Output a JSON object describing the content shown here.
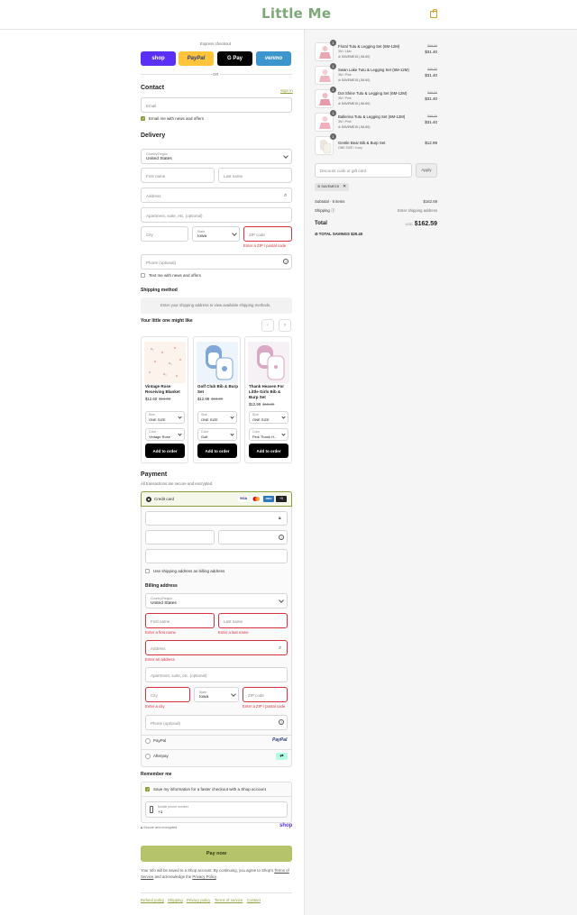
{
  "header": {
    "logo": "Little Me"
  },
  "express": {
    "label": "Express checkout",
    "buttons": [
      "shop",
      "PayPal",
      "G Pay",
      "venmo"
    ],
    "or": "OR"
  },
  "contact": {
    "title": "Contact",
    "signin": "Sign in",
    "email_placeholder": "Email",
    "news_label": "Email me with news and offers"
  },
  "delivery": {
    "title": "Delivery",
    "country_label": "Country/Region",
    "country_value": "United States",
    "first_name": "First name",
    "last_name": "Last name",
    "address": "Address",
    "apartment": "Apartment, suite, etc. (optional)",
    "city": "City",
    "state_label": "State",
    "state_value": "Iowa",
    "zip": "ZIP code",
    "zip_error": "Enter a ZIP / postal code",
    "phone": "Phone (optional)",
    "text_label": "Text me with news and offers"
  },
  "shipping": {
    "title": "Shipping method",
    "message": "Enter your shipping address to view available shipping methods."
  },
  "upsell": {
    "title": "Your little one might like",
    "products": [
      {
        "name": "Vintage Rose Receiving Blanket",
        "price": "$12.60",
        "old": "$18.00",
        "size_label": "Size",
        "size": "ONE SIZE",
        "color_label": "Color",
        "color": "Vintage Rose",
        "button": "Add to order"
      },
      {
        "name": "Golf Club Bib & Burp Set",
        "price": "$12.99",
        "old": "$18.00",
        "size_label": "Size",
        "size": "ONE SIZE",
        "color_label": "Color",
        "color": "Golf",
        "button": "Add to order"
      },
      {
        "name": "Thank Heaven For Little Girls Bib & Burp Set",
        "price": "$12.99",
        "old": "$18.00",
        "size_label": "Size",
        "size": "ONE SIZE",
        "color_label": "Color",
        "color": "Pink Thank H...",
        "button": "Add to order"
      }
    ]
  },
  "payment": {
    "title": "Payment",
    "subtitle": "All transactions are secure and encrypted.",
    "credit_card": "Credit card",
    "cards": [
      "VISA",
      "MC",
      "AMEX",
      "+5"
    ],
    "billing_same": "Use shipping address as billing address",
    "billing_title": "Billing address",
    "country_label": "Country/Region",
    "country_value": "United States",
    "first_name": "First name",
    "first_error": "Enter a first name",
    "last_name": "Last name",
    "last_error": "Enter a last name",
    "address": "Address",
    "address_error": "Enter an address",
    "apartment": "Apartment, suite, etc. (optional)",
    "city": "City",
    "city_error": "Enter a city",
    "state_label": "State",
    "state_value": "Iowa",
    "zip": "ZIP code",
    "zip_error": "Enter a ZIP / postal code",
    "phone": "Phone (optional)",
    "paypal": "PayPal",
    "paypal_logo": "PayPal",
    "afterpay": "Afterpay"
  },
  "remember": {
    "title": "Remember me",
    "save_label": "Save my information for a faster checkout with a Shop account",
    "mobile_label": "Mobile phone number",
    "mobile_value": "+1",
    "secure": "Secure and encrypted",
    "shop": "shop"
  },
  "pay_now": "Pay now",
  "disclaimer_pre": "Your info will be saved to a Shop account. By continuing, you agree to Shop's ",
  "terms": "Terms of Service",
  "disclaimer_mid": " and acknowledge the ",
  "privacy": "Privacy Policy",
  "disclaimer_end": ".",
  "footer": [
    "Refund policy",
    "Shipping",
    "Privacy policy",
    "Terms of service",
    "Contact"
  ],
  "order": {
    "items": [
      {
        "qty": "1",
        "name": "Floral Tutu & Legging Set (6M-12M)",
        "variant": "3M / Lilac",
        "discount": "SAVEME15 (-$4.60)",
        "old": "$46.00",
        "price": "$31.40"
      },
      {
        "qty": "1",
        "name": "Swan Lake Tutu & Legging Set (6M-12M)",
        "variant": "3M / Pink",
        "discount": "SAVEME15 (-$4.60)",
        "old": "$46.00",
        "price": "$31.40"
      },
      {
        "qty": "1",
        "name": "Dot Shine Tutu & Legging Set (6M-12M)",
        "variant": "3M / Pink",
        "discount": "SAVEME15 (-$4.60)",
        "old": "$46.00",
        "price": "$31.40"
      },
      {
        "qty": "1",
        "name": "Ballerina Tutu & Legging Set (6M-12M)",
        "variant": "3M / Pink",
        "discount": "SAVEME15 (-$4.60)",
        "old": "$46.00",
        "price": "$31.40"
      },
      {
        "qty": "1",
        "name": "Gentle Bear Bib & Burp Set",
        "variant": "ONE SIZE / Ivory",
        "discount": "",
        "old": "",
        "price": "$12.99"
      }
    ],
    "discount_placeholder": "Discount code or gift card",
    "apply": "Apply",
    "code_tag": "SAVEME15",
    "subtotal_label": "Subtotal · 5 items",
    "subtotal": "$162.59",
    "shipping_label": "Shipping",
    "shipping_value": "Enter shipping address",
    "total_label": "Total",
    "currency": "USD",
    "total": "$162.59",
    "savings_label": "TOTAL SAVINGS",
    "savings": "$20.40"
  },
  "colors": {
    "accent": "#8aa037",
    "error": "#d9303e",
    "paynow": "#b5c46a"
  }
}
